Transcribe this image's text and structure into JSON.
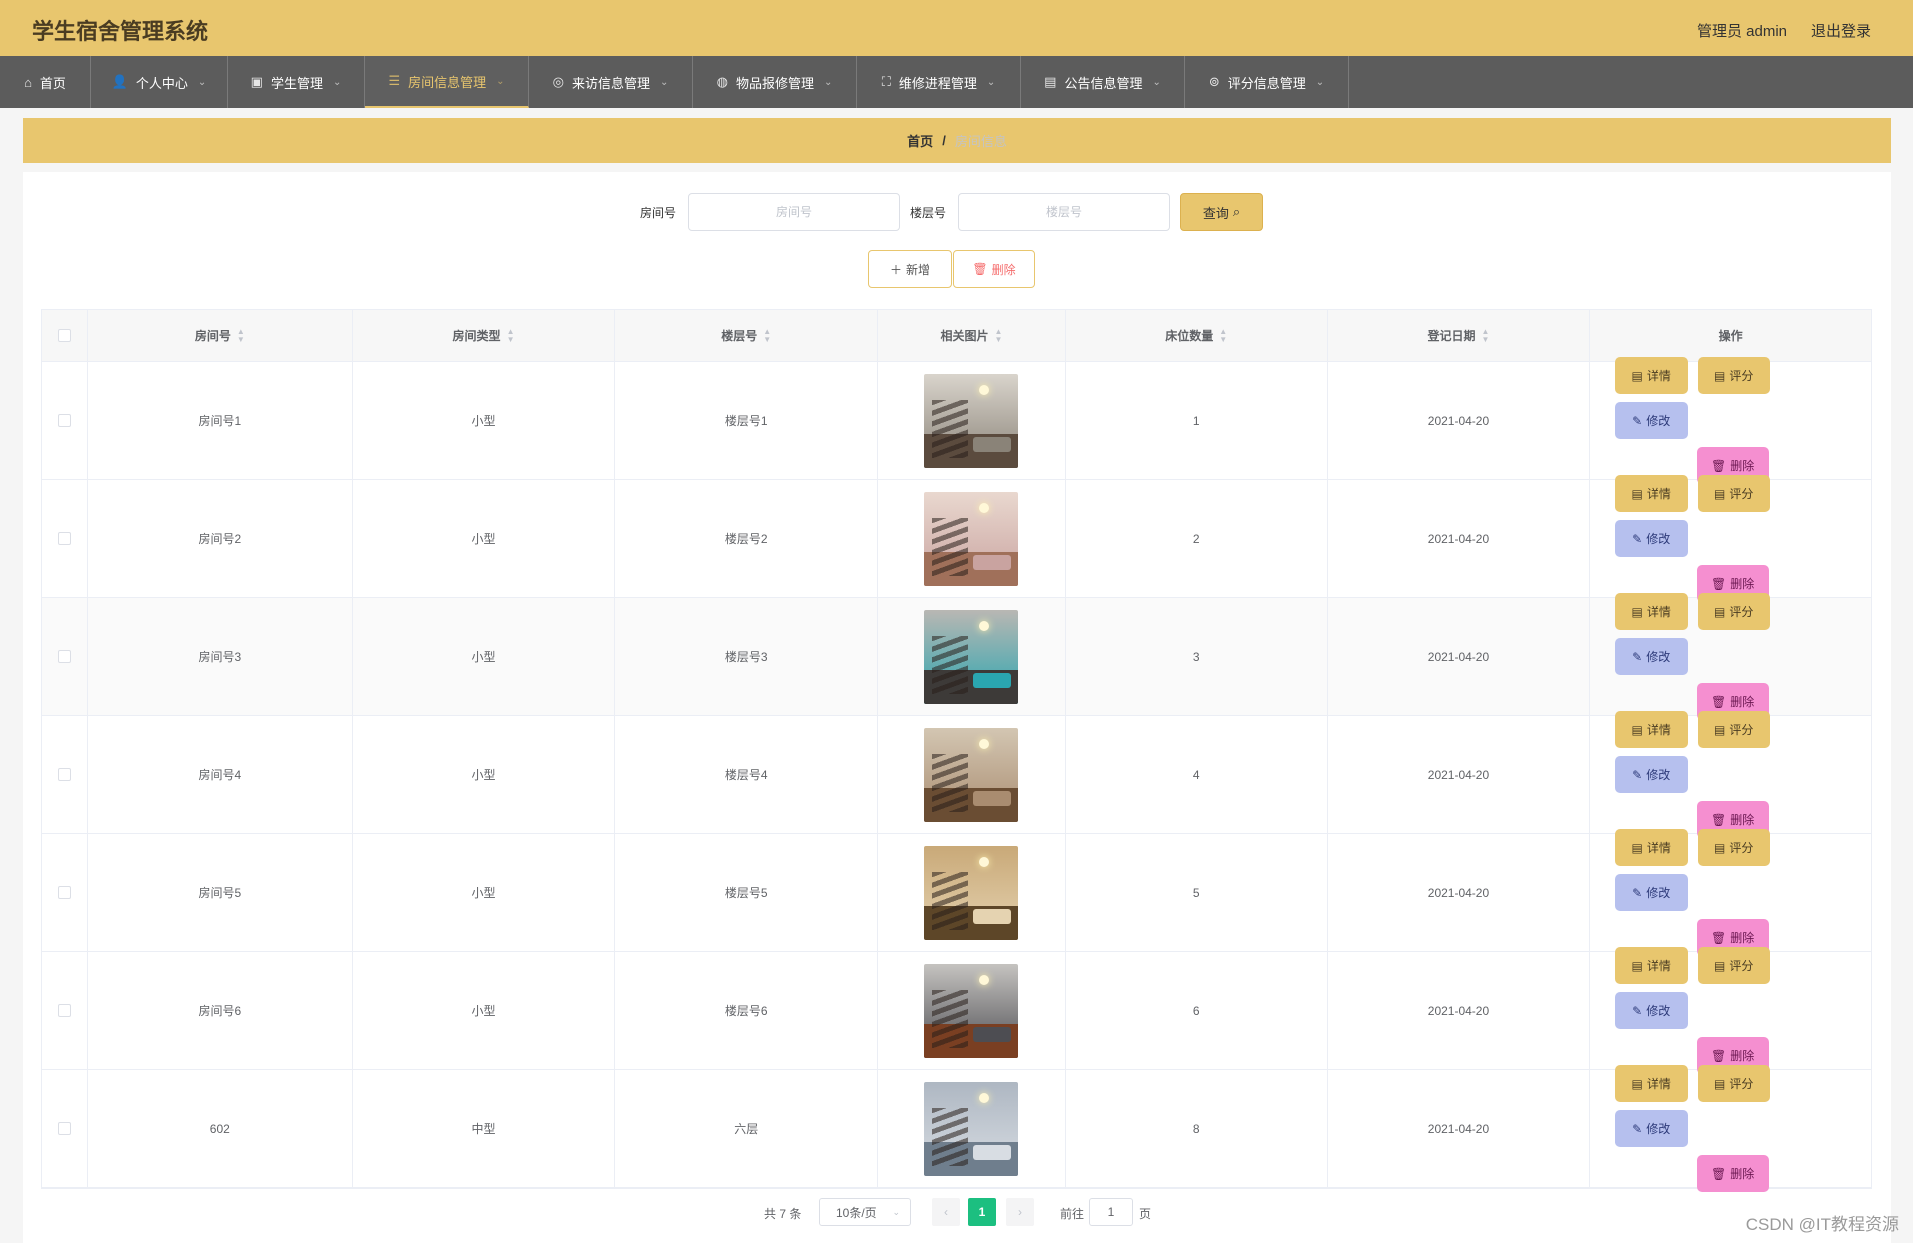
{
  "app": {
    "title": "学生宿舍管理系统",
    "admin": "管理员 admin",
    "logout": "退出登录"
  },
  "nav": [
    {
      "label": "首页",
      "icon": "home-icon",
      "glyph": "⌂"
    },
    {
      "label": "个人中心",
      "icon": "user-icon",
      "glyph": "👤"
    },
    {
      "label": "学生管理",
      "icon": "chart-icon",
      "glyph": "▣"
    },
    {
      "label": "房间信息管理",
      "icon": "menu-icon",
      "glyph": "☰"
    },
    {
      "label": "来访信息管理",
      "icon": "compass-icon",
      "glyph": "◎"
    },
    {
      "label": "物品报修管理",
      "icon": "basketball-icon",
      "glyph": "◍"
    },
    {
      "label": "维修进程管理",
      "icon": "fullscreen-icon",
      "glyph": "⛶"
    },
    {
      "label": "公告信息管理",
      "icon": "clipboard-icon",
      "glyph": "▤"
    },
    {
      "label": "评分信息管理",
      "icon": "rating-icon",
      "glyph": "⊚"
    }
  ],
  "active_nav": "房间信息管理",
  "breadcrumb": {
    "home": "首页",
    "sep": "/",
    "current": "房间信息"
  },
  "search": {
    "room_label": "房间号",
    "room_placeholder": "房间号",
    "floor_label": "楼层号",
    "floor_placeholder": "楼层号",
    "query": "查询"
  },
  "actions": {
    "add": "新增",
    "delete": "删除"
  },
  "table": {
    "headers": [
      "房间号",
      "房间类型",
      "楼层号",
      "相关图片",
      "床位数量",
      "登记日期",
      "操作"
    ],
    "rows": [
      {
        "room": "房间号1",
        "type": "小型",
        "floor": "楼层号1",
        "beds": "1",
        "date": "2021-04-20"
      },
      {
        "room": "房间号2",
        "type": "小型",
        "floor": "楼层号2",
        "beds": "2",
        "date": "2021-04-20"
      },
      {
        "room": "房间号3",
        "type": "小型",
        "floor": "楼层号3",
        "beds": "3",
        "date": "2021-04-20"
      },
      {
        "room": "房间号4",
        "type": "小型",
        "floor": "楼层号4",
        "beds": "4",
        "date": "2021-04-20"
      },
      {
        "room": "房间号5",
        "type": "小型",
        "floor": "楼层号5",
        "beds": "5",
        "date": "2021-04-20"
      },
      {
        "room": "房间号6",
        "type": "小型",
        "floor": "楼层号6",
        "beds": "6",
        "date": "2021-04-20"
      },
      {
        "room": "602",
        "type": "中型",
        "floor": "六层",
        "beds": "8",
        "date": "2021-04-20"
      }
    ],
    "ops": {
      "detail": "详情",
      "rate": "评分",
      "edit": "修改",
      "delete": "删除"
    }
  },
  "pagination": {
    "total": "共 7 条",
    "size": "10条/页",
    "current": "1",
    "goto": "前往",
    "goto_value": "1",
    "page": "页"
  },
  "watermark": "CSDN @IT教程资源",
  "colors": {
    "accent": "#e8c66e",
    "nav_bg": "#5c5c5c",
    "edit": "#b6c0ee",
    "delete": "#f58fd0",
    "page_active": "#1cbf80"
  }
}
